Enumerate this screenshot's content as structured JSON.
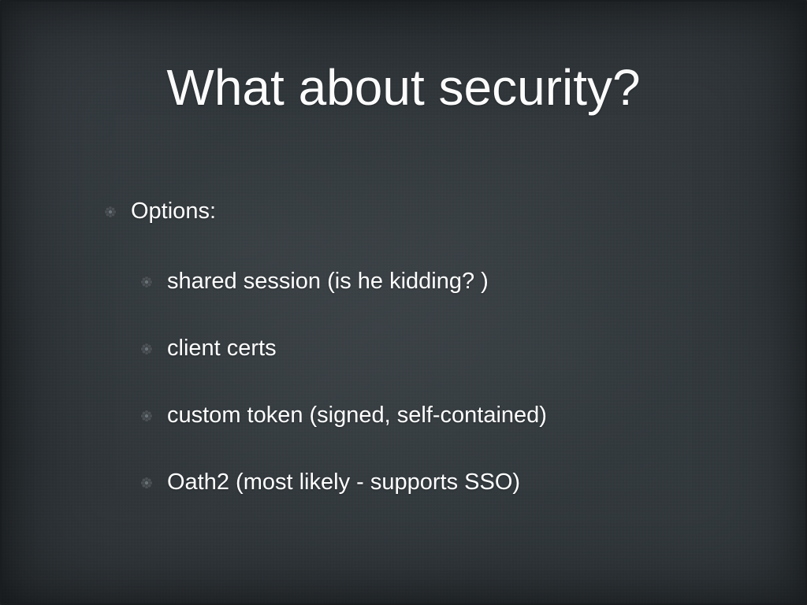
{
  "slide": {
    "title": "What about security?",
    "bullets": [
      {
        "level": 0,
        "text": "Options:"
      },
      {
        "level": 1,
        "text": "shared session (is he kidding? )"
      },
      {
        "level": 1,
        "text": "client certs"
      },
      {
        "level": 1,
        "text": "custom token (signed, self-contained)"
      },
      {
        "level": 1,
        "text": "Oath2 (most likely - supports SSO)"
      }
    ]
  }
}
